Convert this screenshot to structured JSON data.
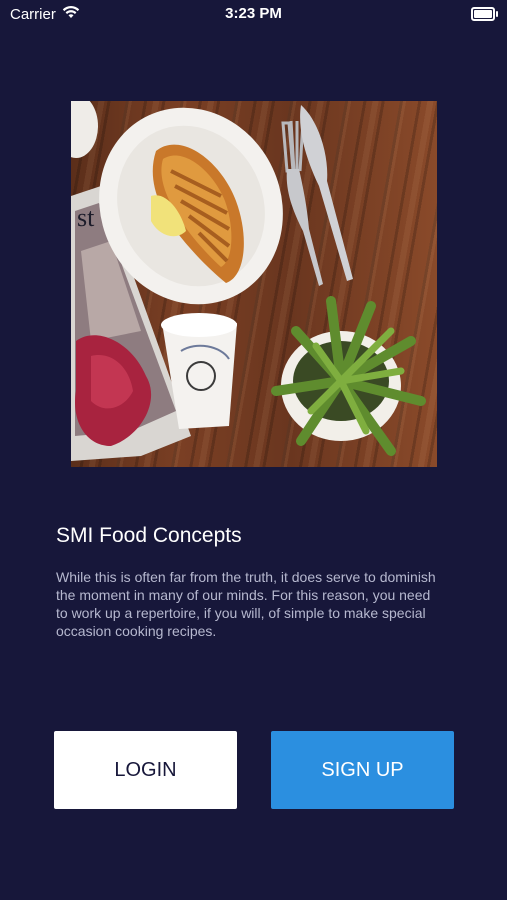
{
  "status_bar": {
    "carrier": "Carrier",
    "time": "3:23 PM",
    "wifi_icon": "wifi-icon",
    "battery_icon": "battery-icon"
  },
  "hero": {
    "image": "food-photo-croissant-coffee"
  },
  "content": {
    "title": "SMI Food Concepts",
    "description": "While this is often far from the truth, it does serve to dominish the moment in many of our minds. For this reason, you need to work up a repertoire, if you will, of simple to make special occasion cooking recipes."
  },
  "buttons": {
    "login_label": "LOGIN",
    "signup_label": "SIGN UP"
  },
  "colors": {
    "background": "#17173a",
    "accent": "#2b8fe0",
    "text_secondary": "#b6b8cf"
  }
}
